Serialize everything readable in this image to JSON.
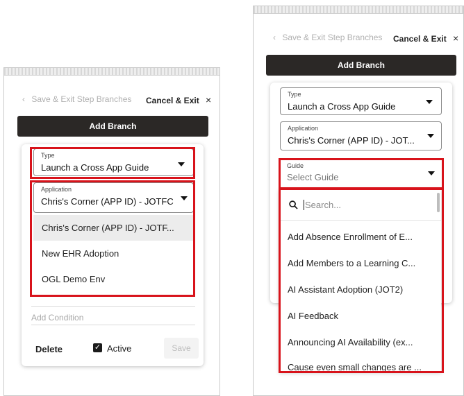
{
  "header": {
    "back_label": "Save & Exit Step Branches",
    "cancel_label": "Cancel & Exit",
    "close_glyph": "×",
    "add_branch_label": "Add Branch"
  },
  "left": {
    "type_field": {
      "label": "Type",
      "value": "Launch a Cross App Guide"
    },
    "application_field": {
      "label": "Application",
      "value": "Chris's Corner (APP ID) - JOTFC"
    },
    "application_options": [
      "Chris's Corner (APP ID) - JOTF...",
      "New EHR Adoption",
      "OGL Demo Env"
    ],
    "add_condition_placeholder": "Add Condition",
    "delete_label": "Delete",
    "active_label": "Active",
    "active_checked": true,
    "save_label": "Save"
  },
  "right": {
    "type_field": {
      "label": "Type",
      "value": "Launch a Cross App Guide"
    },
    "application_field": {
      "label": "Application",
      "value": "Chris's Corner (APP ID) - JOT..."
    },
    "guide_field": {
      "label": "Guide",
      "placeholder": "Select Guide"
    },
    "search_placeholder": "Search...",
    "guide_options": [
      "Add Absence Enrollment of E...",
      "Add Members to a Learning C...",
      "AI Assistant Adoption (JOT2)",
      "AI Feedback",
      "Announcing AI Availability (ex...",
      "Cause even small changes are ..."
    ]
  },
  "colors": {
    "highlight": "#d8131b",
    "dark_button": "#2b2826"
  }
}
